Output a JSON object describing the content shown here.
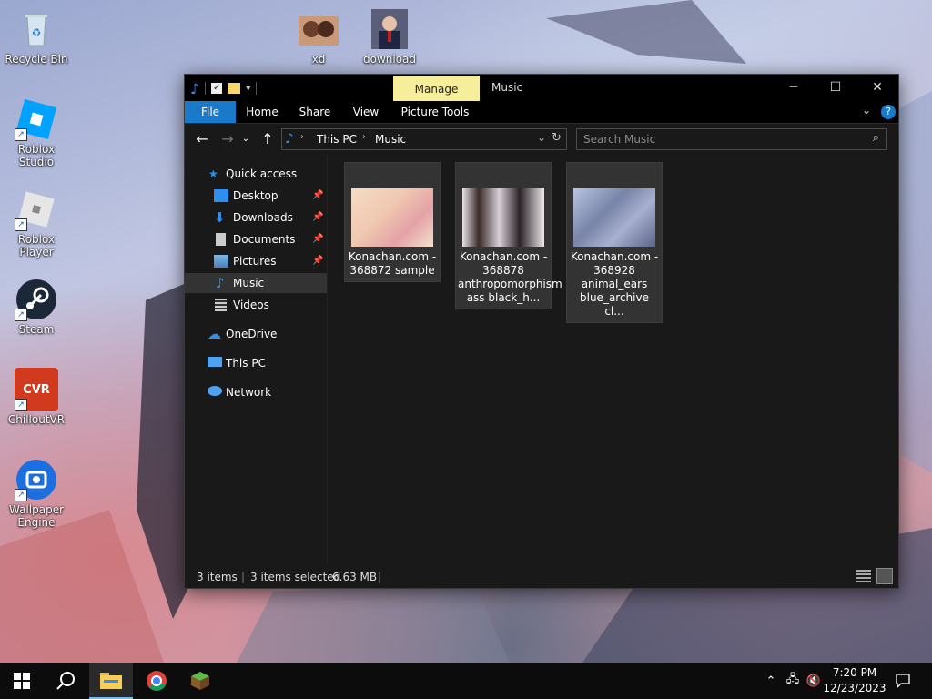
{
  "desktop": {
    "icons": [
      {
        "label": "Recycle Bin"
      },
      {
        "label": "Roblox Studio"
      },
      {
        "label": "Roblox Player"
      },
      {
        "label": "Steam"
      },
      {
        "label": "ChilloutVR"
      },
      {
        "label": "Wallpaper Engine"
      },
      {
        "label": "xd"
      },
      {
        "label": "download"
      }
    ]
  },
  "explorer": {
    "title": "Music",
    "context_tab": "Manage",
    "ribbon_tabs": [
      "File",
      "Home",
      "Share",
      "View",
      "Picture Tools"
    ],
    "address": {
      "segments": [
        "This PC",
        "Music"
      ]
    },
    "search_placeholder": "Search Music",
    "nav": {
      "quick_access": "Quick access",
      "items": [
        {
          "label": "Desktop",
          "pinned": true
        },
        {
          "label": "Downloads",
          "pinned": true
        },
        {
          "label": "Documents",
          "pinned": true
        },
        {
          "label": "Pictures",
          "pinned": true
        },
        {
          "label": "Music",
          "selected": true
        },
        {
          "label": "Videos"
        }
      ],
      "onedrive": "OneDrive",
      "this_pc": "This PC",
      "network": "Network"
    },
    "files": [
      {
        "name": "Konachan.com - 368872 sample"
      },
      {
        "name": "Konachan.com - 368878 anthropomorphism ass black_h..."
      },
      {
        "name": "Konachan.com - 368928 animal_ears blue_archive cl..."
      }
    ],
    "status": {
      "items": "3 items",
      "selected": "3 items selected",
      "size": "6.63 MB"
    }
  },
  "taskbar": {
    "time": "7:20 PM",
    "date": "12/23/2023"
  },
  "colors": {
    "accent": "#1979ca",
    "manage_tab": "#f7ee9b",
    "window_bg": "#191919"
  }
}
